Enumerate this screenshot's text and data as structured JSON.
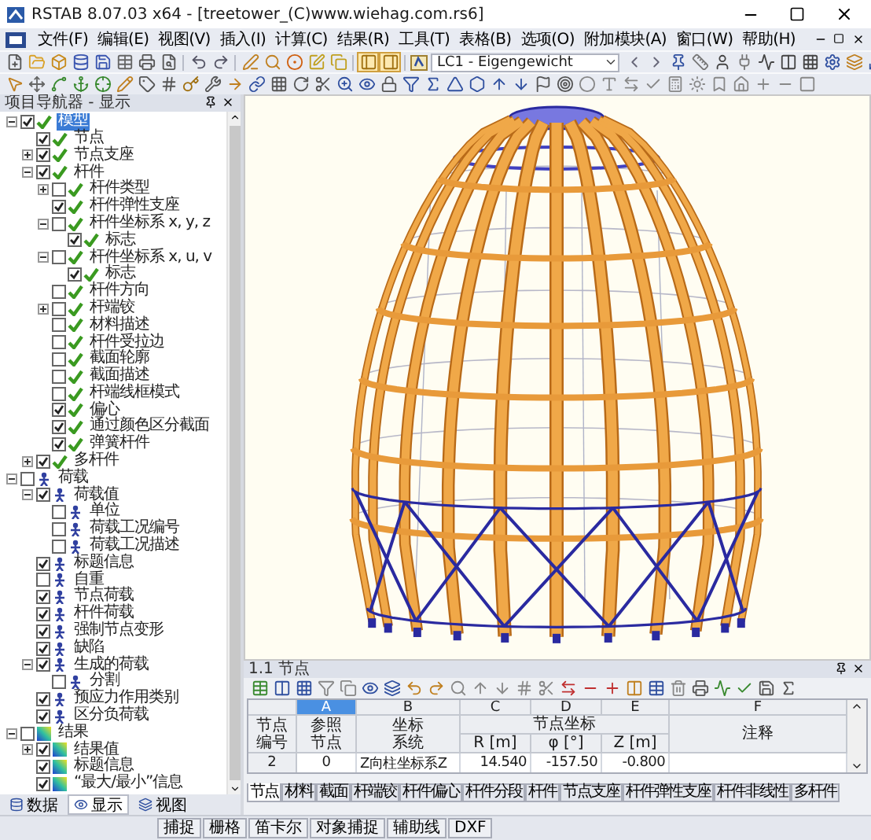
{
  "window": {
    "title": "RSTAB 8.07.03 x64 - [treetower_(C)www.wiehag.com.rs6]"
  },
  "menu": [
    "文件(F)",
    "编辑(E)",
    "视图(V)",
    "插入(I)",
    "计算(C)",
    "结果(R)",
    "工具(T)",
    "表格(B)",
    "选项(O)",
    "附加模块(A)",
    "窗口(W)",
    "帮助(H)"
  ],
  "load_case": {
    "value": "LC1 - Eigengewicht"
  },
  "navigator": {
    "title": "项目导航器 - 显示",
    "tree": [
      {
        "label": "模型",
        "kind": "model",
        "checked": true,
        "selected": true,
        "expanded": true,
        "children": [
          {
            "label": "节点",
            "checked": true,
            "selected": false
          },
          {
            "label": "节点支座",
            "checked": true,
            "selected": false,
            "expanded": false
          },
          {
            "label": "杆件",
            "checked": true,
            "selected": false,
            "expanded": true,
            "children": [
              {
                "label": "杆件类型",
                "checked": false,
                "selected": false,
                "expanded": false
              },
              {
                "label": "杆件弹性支座",
                "checked": true,
                "selected": false
              },
              {
                "label": "杆件坐标系 x, y, z",
                "checked": false,
                "selected": false,
                "expanded": true,
                "children": [
                  {
                    "label": "标志",
                    "checked": true,
                    "selected": false
                  }
                ]
              },
              {
                "label": "杆件坐标系 x, u, v",
                "checked": false,
                "selected": false,
                "expanded": true,
                "children": [
                  {
                    "label": "标志",
                    "checked": true,
                    "selected": false
                  }
                ]
              },
              {
                "label": "杆件方向",
                "checked": false,
                "selected": false
              },
              {
                "label": "杆端铰",
                "checked": false,
                "selected": false,
                "expanded": false
              },
              {
                "label": "材料描述",
                "checked": false,
                "selected": false
              },
              {
                "label": "杆件受拉边",
                "checked": false,
                "selected": false
              },
              {
                "label": "截面轮廓",
                "checked": false,
                "selected": false
              },
              {
                "label": "截面描述",
                "checked": false,
                "selected": false
              },
              {
                "label": "杆端线框模式",
                "checked": false,
                "selected": false
              },
              {
                "label": "偏心",
                "checked": true,
                "selected": false
              },
              {
                "label": "通过颜色区分截面",
                "checked": true,
                "selected": false
              },
              {
                "label": "弹簧杆件",
                "checked": true,
                "selected": false
              }
            ]
          },
          {
            "label": "多杆件",
            "checked": true,
            "selected": false,
            "expanded": false
          }
        ]
      },
      {
        "label": "荷载",
        "kind": "load",
        "checked": false,
        "selected": false,
        "expanded": true,
        "children": [
          {
            "label": "荷载值",
            "checked": true,
            "selected": false,
            "expanded": true,
            "children": [
              {
                "label": "单位",
                "checked": false,
                "selected": false
              },
              {
                "label": "荷载工况编号",
                "checked": false,
                "selected": false
              },
              {
                "label": "荷载工况描述",
                "checked": false,
                "selected": false
              }
            ]
          },
          {
            "label": "标题信息",
            "checked": true,
            "selected": false
          },
          {
            "label": "自重",
            "checked": false,
            "selected": false
          },
          {
            "label": "节点荷载",
            "checked": true,
            "selected": false
          },
          {
            "label": "杆件荷载",
            "checked": true,
            "selected": false
          },
          {
            "label": "强制节点变形",
            "checked": true,
            "selected": false
          },
          {
            "label": "缺陷",
            "checked": true,
            "selected": false
          },
          {
            "label": "生成的荷载",
            "checked": true,
            "selected": false,
            "expanded": true,
            "children": [
              {
                "label": "分割",
                "checked": false,
                "selected": false
              }
            ]
          },
          {
            "label": "预应力作用类别",
            "checked": true,
            "selected": false
          },
          {
            "label": "区分负荷载",
            "checked": true,
            "selected": false
          }
        ]
      },
      {
        "label": "结果",
        "kind": "result",
        "checked": false,
        "selected": false,
        "expanded": true,
        "children": [
          {
            "label": "结果值",
            "checked": true,
            "selected": false,
            "expanded": false
          },
          {
            "label": "标题信息",
            "checked": true,
            "selected": false
          },
          {
            "label": "“最大/最小”信息",
            "checked": true,
            "selected": false
          }
        ]
      }
    ],
    "tabs": [
      {
        "label": "数据",
        "selected": false
      },
      {
        "label": "显示",
        "selected": true
      },
      {
        "label": "视图",
        "selected": false
      }
    ]
  },
  "table_panel": {
    "title": "1.1 节点",
    "row_header_lines": [
      "节点",
      "编号"
    ],
    "group_title": "节点坐标",
    "columns": [
      {
        "letter": "A",
        "selected": true,
        "grouped": false,
        "title_lines": [
          "参照",
          "节点"
        ]
      },
      {
        "letter": "B",
        "selected": false,
        "grouped": false,
        "title_lines": [
          "坐标",
          "系统"
        ]
      },
      {
        "letter": "C",
        "selected": false,
        "grouped": true,
        "title_lines": [
          "R [m]"
        ]
      },
      {
        "letter": "D",
        "selected": false,
        "grouped": true,
        "title_lines": [
          "φ [°]"
        ]
      },
      {
        "letter": "E",
        "selected": false,
        "grouped": true,
        "title_lines": [
          "Z [m]"
        ]
      },
      {
        "letter": "F",
        "selected": false,
        "grouped": false,
        "title_lines": [
          "注释"
        ]
      }
    ],
    "rows": [
      {
        "number": "2",
        "cells": [
          "0",
          "Z向柱坐标系Z",
          "14.540",
          "-157.50",
          "-0.800"
        ]
      }
    ],
    "tabs": [
      {
        "label": "节点",
        "selected": true
      },
      {
        "label": "材料",
        "selected": false
      },
      {
        "label": "截面",
        "selected": false
      },
      {
        "label": "杆端铰",
        "selected": false
      },
      {
        "label": "杆件偏心",
        "selected": false
      },
      {
        "label": "杆件分段",
        "selected": false
      },
      {
        "label": "杆件",
        "selected": false
      },
      {
        "label": "节点支座",
        "selected": false
      },
      {
        "label": "杆件弹性支座",
        "selected": false
      },
      {
        "label": "杆件非线性",
        "selected": false
      },
      {
        "label": "多杆件",
        "selected": false
      }
    ]
  },
  "status_bar": [
    "捕捉",
    "栅格",
    "笛卡尔",
    "对象捕捉",
    "辅助线",
    "DXF"
  ]
}
